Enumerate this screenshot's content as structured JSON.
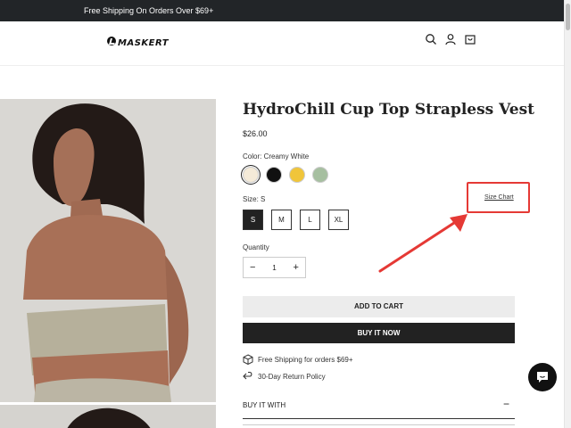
{
  "announcement": "Free Shipping On Orders Over $69+",
  "header": {
    "logo_text": "MASKERT",
    "icons": [
      "search-icon",
      "account-icon",
      "cart-icon"
    ]
  },
  "product": {
    "title": "HydroChill Cup Top Strapless Vest",
    "price": "$26.00",
    "color_label": "Color: Creamy White",
    "swatches": [
      {
        "name": "Creamy White",
        "color": "#f4ead8"
      },
      {
        "name": "Black",
        "color": "#111111"
      },
      {
        "name": "Yellow",
        "color": "#f0c53a"
      },
      {
        "name": "Sage",
        "color": "#a6bfa0"
      }
    ],
    "size_label": "Size: S",
    "size_chart": "Size Chart",
    "sizes": [
      "S",
      "M",
      "L",
      "XL"
    ],
    "selected_size": "S",
    "quantity_label": "Quantity",
    "quantity": "1",
    "qty_minus": "−",
    "qty_plus": "+",
    "add_to_cart": "ADD TO CART",
    "buy_now": "BUY IT NOW",
    "perks": [
      {
        "icon": "box-icon",
        "text": "Free Shipping for orders $69+"
      },
      {
        "icon": "return-arrow-icon",
        "text": "30-Day Return Policy"
      }
    ],
    "accordion": {
      "label": "BUY IT WITH",
      "toggle": "−"
    }
  },
  "colors": {
    "announce_bg": "#222528",
    "primary_button": "#222222",
    "secondary_button": "#ececec",
    "highlight": "#e53935"
  },
  "chat_icon": "chat-bubble-icon"
}
